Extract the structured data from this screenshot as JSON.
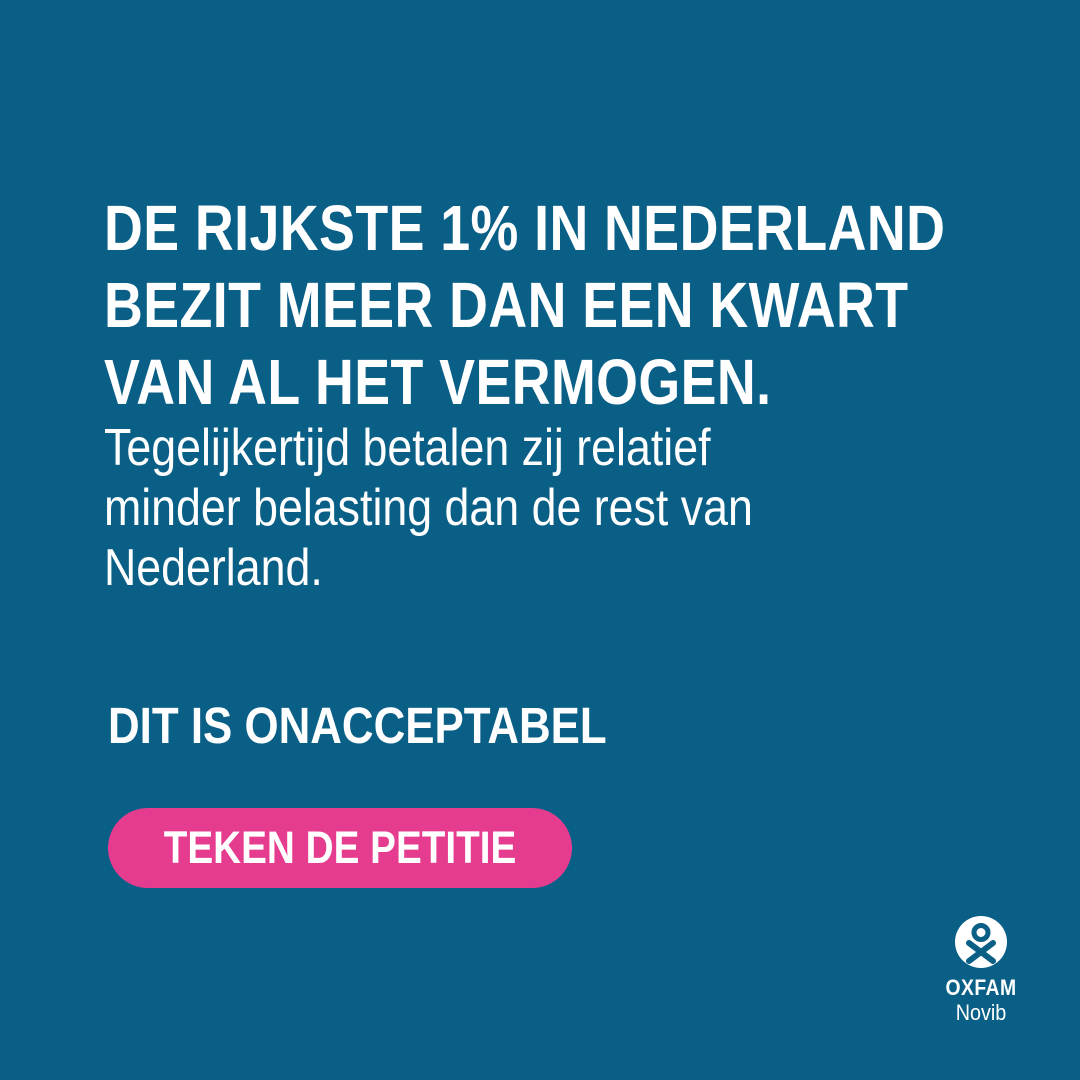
{
  "colors": {
    "background": "#0a5f87",
    "text": "#ffffff",
    "button": "#e63c8f"
  },
  "headline": {
    "lines": [
      "DE RIJKSTE 1% IN NEDERLAND",
      "BEZIT MEER DAN EEN KWART",
      "VAN AL HET VERMOGEN."
    ]
  },
  "subtext": {
    "lines": [
      "Tegelijkertijd betalen zij relatief",
      "minder belasting dan de rest van",
      "Nederland."
    ]
  },
  "statement": "DIT IS ONACCEPTABEL",
  "cta": {
    "label": "TEKEN DE PETITIE"
  },
  "logo": {
    "icon": "oxfam-figure-icon",
    "name": "OXFAM",
    "sub": "Novib"
  }
}
